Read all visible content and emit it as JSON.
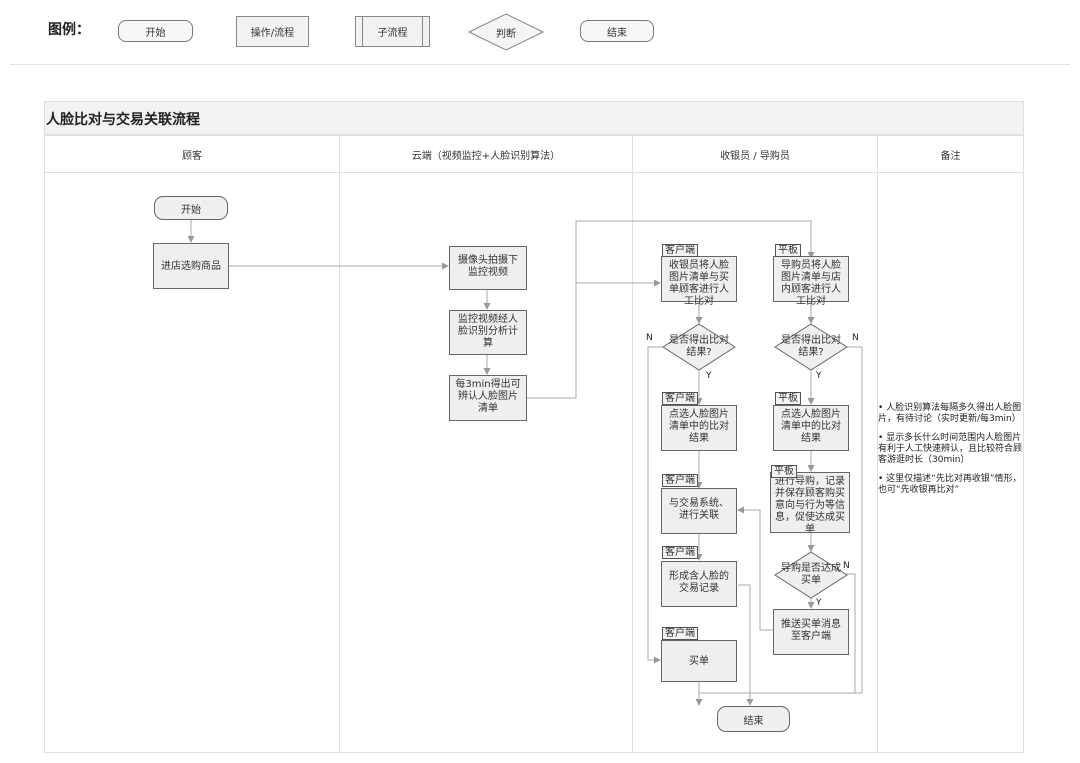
{
  "legend": {
    "title": "图例：",
    "start": "开始",
    "process": "操作/流程",
    "subprocess": "子流程",
    "decision": "判断",
    "end": "结束"
  },
  "diagram": {
    "title": "人脸比对与交易关联流程",
    "lanes": [
      "顾客",
      "云端（视频监控+人脸识别算法）",
      "收银员 / 导购员",
      "备注"
    ]
  },
  "nodes": {
    "start": "开始",
    "browse": "进店选购商品",
    "camera": "摄像头拍摄下\n监控视频",
    "analyze": "监控视频经人\n脸识别分析计\n算",
    "every3min": "每3min得出可\n辨认人脸图片\n清单",
    "tag_client": "客户端",
    "tag_tablet": "平板",
    "cashier_compare": "收银员将人脸\n图片清单与买\n单顾客进行人\n工比对",
    "guide_compare": "导购员将人脸\n图片清单与店\n内顾客进行人\n工比对",
    "decision_cashier": "是否得出比对\n结果?",
    "decision_guide": "是否得出比对\n结果?",
    "select_cashier": "点选人脸图片\n清单中的比对\n结果",
    "select_guide": "点选人脸图片\n清单中的比对\n结果",
    "link_trade": "与交易系统、\n进行关联",
    "guide_record": "进行导购，记录\n并保存顾客购买\n意向与行为等信\n息，促使达成买\n单",
    "decision_buy": "导购是否达成\n买单",
    "form_record": "形成含人脸的\n交易记录",
    "push": "推送买单消息\n至客户端",
    "checkout": "买单",
    "end": "结束",
    "yes": "Y",
    "no": "N"
  },
  "notes": [
    "• 人脸识别算法每隔多久得出人脸图片，有待讨论（实时更新/每3min）",
    "• 显示多长什么时间范围内人脸图片有利于人工快速辨认，且比较符合顾客游逛时长（30min）",
    "• 这里仅描述“先比对再收银”情形，也可“先收银再比对”"
  ]
}
